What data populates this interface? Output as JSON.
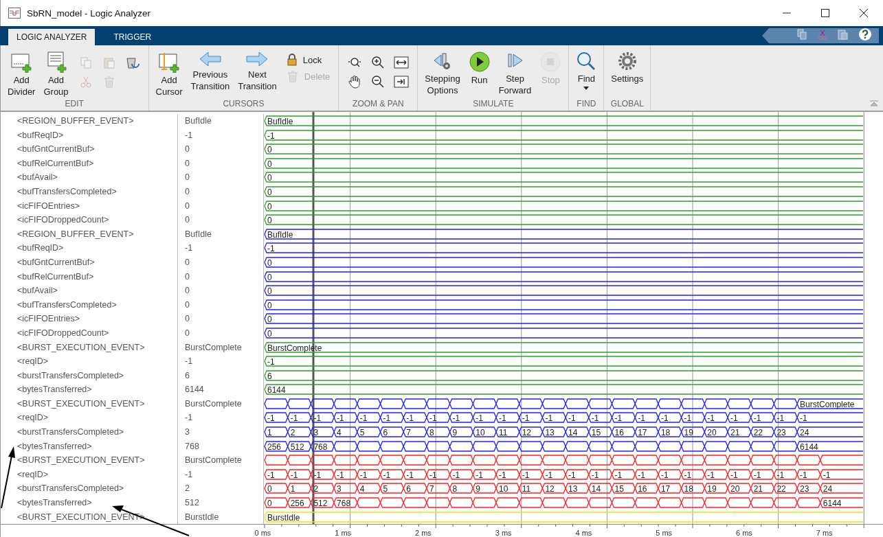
{
  "window": {
    "title": "SbRN_model - Logic Analyzer"
  },
  "tabs": [
    {
      "label": "LOGIC ANALYZER",
      "selected": true
    },
    {
      "label": "TRIGGER",
      "selected": false
    }
  ],
  "toolstrip": [
    {
      "title": "EDIT",
      "items": [
        {
          "kind": "large",
          "label": "Add Divider",
          "disabled": false
        },
        {
          "kind": "large",
          "label": "Add Group",
          "disabled": false
        },
        {
          "kind": "icon-grid",
          "buttons": [
            {
              "disabled": true
            },
            {
              "disabled": true
            },
            {
              "disabled": false
            },
            {
              "disabled": true
            },
            {
              "disabled": true
            }
          ]
        }
      ]
    },
    {
      "title": "CURSORS",
      "items": [
        {
          "kind": "large",
          "label": "Add Cursor",
          "disabled": false
        },
        {
          "kind": "large",
          "label": "Previous Transition",
          "disabled": false
        },
        {
          "kind": "large",
          "label": "Next Transition",
          "disabled": false
        },
        {
          "kind": "small-list",
          "buttons": [
            {
              "label": "Lock",
              "disabled": false
            },
            {
              "label": "Delete",
              "disabled": true
            }
          ]
        }
      ]
    },
    {
      "title": "ZOOM & PAN",
      "items": [
        {
          "kind": "icon-grid",
          "buttons": [
            {
              "disabled": false
            },
            {
              "disabled": false
            },
            {
              "disabled": false
            },
            {
              "disabled": false
            },
            {
              "disabled": false
            },
            {
              "disabled": false
            }
          ]
        }
      ]
    },
    {
      "title": "SIMULATE",
      "items": [
        {
          "kind": "large",
          "label": "Stepping Options",
          "disabled": false
        },
        {
          "kind": "large",
          "label": "Run",
          "disabled": false
        },
        {
          "kind": "large",
          "label": "Step Forward",
          "disabled": false
        },
        {
          "kind": "large",
          "label": "Stop",
          "disabled": true
        }
      ]
    },
    {
      "title": "FIND",
      "items": [
        {
          "kind": "large",
          "label": "Find",
          "disabled": false,
          "dropdown": true
        }
      ]
    },
    {
      "title": "GLOBAL",
      "items": [
        {
          "kind": "large",
          "label": "Settings",
          "disabled": false
        }
      ]
    }
  ],
  "signals": [
    {
      "name": "<REGION_BUFFER_EVENT>",
      "value": "BufIdle",
      "color": "#2ca02c",
      "segments": [
        {
          "kind": "value",
          "label": "BufIdle"
        }
      ]
    },
    {
      "name": "<bufReqID>",
      "value": "-1",
      "color": "#2ca02c",
      "segments": [
        {
          "kind": "value",
          "label": "-1"
        }
      ]
    },
    {
      "name": "<bufGntCurrentBuf>",
      "value": "0",
      "color": "#2ca02c",
      "segments": [
        {
          "kind": "value",
          "label": "0"
        }
      ]
    },
    {
      "name": "<bufRelCurrentBuf>",
      "value": "0",
      "color": "#2ca02c",
      "segments": [
        {
          "kind": "value",
          "label": "0"
        }
      ]
    },
    {
      "name": "<bufAvail>",
      "value": "0",
      "color": "#2ca02c",
      "segments": [
        {
          "kind": "value",
          "label": "0"
        }
      ]
    },
    {
      "name": "<bufTransfersCompleted>",
      "value": "0",
      "color": "#2ca02c",
      "segments": [
        {
          "kind": "value",
          "label": "0"
        }
      ]
    },
    {
      "name": "<icFIFOEntries>",
      "value": "0",
      "color": "#2ca02c",
      "segments": [
        {
          "kind": "value",
          "label": "0"
        }
      ]
    },
    {
      "name": "<icFIFODroppedCount>",
      "value": "0",
      "color": "#2ca02c",
      "segments": [
        {
          "kind": "value",
          "label": "0"
        }
      ]
    },
    {
      "name": "<REGION_BUFFER_EVENT>",
      "value": "BufIdle",
      "color": "#2020ff",
      "segments": [
        {
          "kind": "value",
          "label": "BufIdle"
        }
      ]
    },
    {
      "name": "<bufReqID>",
      "value": "-1",
      "color": "#2020ff",
      "segments": [
        {
          "kind": "value",
          "label": "-1"
        }
      ]
    },
    {
      "name": "<bufGntCurrentBuf>",
      "value": "0",
      "color": "#2020ff",
      "segments": [
        {
          "kind": "value",
          "label": "0"
        }
      ]
    },
    {
      "name": "<bufRelCurrentBuf>",
      "value": "0",
      "color": "#2020ff",
      "segments": [
        {
          "kind": "value",
          "label": "0"
        }
      ]
    },
    {
      "name": "<bufAvail>",
      "value": "0",
      "color": "#2020ff",
      "segments": [
        {
          "kind": "value",
          "label": "0"
        }
      ]
    },
    {
      "name": "<bufTransfersCompleted>",
      "value": "0",
      "color": "#2020ff",
      "segments": [
        {
          "kind": "value",
          "label": "0"
        }
      ]
    },
    {
      "name": "<icFIFOEntries>",
      "value": "0",
      "color": "#2020ff",
      "segments": [
        {
          "kind": "value",
          "label": "0"
        }
      ]
    },
    {
      "name": "<icFIFODroppedCount>",
      "value": "0",
      "color": "#2020ff",
      "segments": [
        {
          "kind": "value",
          "label": "0"
        }
      ]
    },
    {
      "name": "<BURST_EXECUTION_EVENT>",
      "value": "BurstComplete",
      "color": "#2ca02c",
      "segments": [
        {
          "kind": "value",
          "label": "BurstComplete"
        }
      ]
    },
    {
      "name": "<reqID>",
      "value": "-1",
      "color": "#2ca02c",
      "segments": [
        {
          "kind": "value",
          "label": "-1"
        }
      ]
    },
    {
      "name": "<burstTransfersCompleted>",
      "value": "6",
      "color": "#2ca02c",
      "segments": [
        {
          "kind": "value",
          "label": "6"
        }
      ]
    },
    {
      "name": "<bytesTransferred>",
      "value": "6144",
      "color": "#2ca02c",
      "segments": [
        {
          "kind": "value",
          "label": "6144"
        }
      ]
    },
    {
      "name": "<BURST_EXECUTION_EVENT>",
      "value": "BurstComplete",
      "color": "#2020ff",
      "segments": [
        {
          "kind": "blank"
        },
        {
          "kind": "blank"
        },
        {
          "kind": "blank"
        },
        {
          "kind": "blank"
        },
        {
          "kind": "blank"
        },
        {
          "kind": "blank"
        },
        {
          "kind": "blank"
        },
        {
          "kind": "blank"
        },
        {
          "kind": "blank"
        },
        {
          "kind": "blank"
        },
        {
          "kind": "blank"
        },
        {
          "kind": "blank"
        },
        {
          "kind": "blank"
        },
        {
          "kind": "blank"
        },
        {
          "kind": "blank"
        },
        {
          "kind": "blank"
        },
        {
          "kind": "blank"
        },
        {
          "kind": "blank"
        },
        {
          "kind": "blank"
        },
        {
          "kind": "blank"
        },
        {
          "kind": "blank"
        },
        {
          "kind": "blank"
        },
        {
          "kind": "blank"
        },
        {
          "kind": "value",
          "label": "BurstComplete"
        }
      ]
    },
    {
      "name": "<reqID>",
      "value": "-1",
      "color": "#2020ff",
      "segments": [
        {
          "kind": "value",
          "label": "-1"
        },
        {
          "kind": "value",
          "label": "-1"
        },
        {
          "kind": "value",
          "label": "-1"
        },
        {
          "kind": "value",
          "label": "-1"
        },
        {
          "kind": "value",
          "label": "-1"
        },
        {
          "kind": "value",
          "label": "-1"
        },
        {
          "kind": "value",
          "label": "-1"
        },
        {
          "kind": "value",
          "label": "-1"
        },
        {
          "kind": "value",
          "label": "-1"
        },
        {
          "kind": "value",
          "label": "-1"
        },
        {
          "kind": "value",
          "label": "-1"
        },
        {
          "kind": "value",
          "label": "-1"
        },
        {
          "kind": "value",
          "label": "-1"
        },
        {
          "kind": "value",
          "label": "-1"
        },
        {
          "kind": "value",
          "label": "-1"
        },
        {
          "kind": "value",
          "label": "-1"
        },
        {
          "kind": "value",
          "label": "-1"
        },
        {
          "kind": "value",
          "label": "-1"
        },
        {
          "kind": "value",
          "label": "-1"
        },
        {
          "kind": "value",
          "label": "-1"
        },
        {
          "kind": "value",
          "label": "-1"
        },
        {
          "kind": "value",
          "label": "-1"
        },
        {
          "kind": "value",
          "label": "-1"
        },
        {
          "kind": "value",
          "label": "-1"
        }
      ]
    },
    {
      "name": "<burstTransfersCompleted>",
      "value": "3",
      "color": "#2020ff",
      "segments": [
        {
          "kind": "value",
          "label": "1"
        },
        {
          "kind": "value",
          "label": "2"
        },
        {
          "kind": "value",
          "label": "3"
        },
        {
          "kind": "value",
          "label": "4"
        },
        {
          "kind": "value",
          "label": "5"
        },
        {
          "kind": "value",
          "label": "6"
        },
        {
          "kind": "value",
          "label": "7"
        },
        {
          "kind": "value",
          "label": "8"
        },
        {
          "kind": "value",
          "label": "9"
        },
        {
          "kind": "value",
          "label": "10"
        },
        {
          "kind": "value",
          "label": "11"
        },
        {
          "kind": "value",
          "label": "12"
        },
        {
          "kind": "value",
          "label": "13"
        },
        {
          "kind": "value",
          "label": "14"
        },
        {
          "kind": "value",
          "label": "15"
        },
        {
          "kind": "value",
          "label": "16"
        },
        {
          "kind": "value",
          "label": "17"
        },
        {
          "kind": "value",
          "label": "18"
        },
        {
          "kind": "value",
          "label": "19"
        },
        {
          "kind": "value",
          "label": "20"
        },
        {
          "kind": "value",
          "label": "21"
        },
        {
          "kind": "value",
          "label": "22"
        },
        {
          "kind": "value",
          "label": "23"
        },
        {
          "kind": "value",
          "label": "24"
        }
      ]
    },
    {
      "name": "<bytesTransferred>",
      "value": "768",
      "color": "#2020ff",
      "segments": [
        {
          "kind": "value",
          "label": "256"
        },
        {
          "kind": "value",
          "label": "512"
        },
        {
          "kind": "value",
          "label": "768"
        },
        {
          "kind": "blank"
        },
        {
          "kind": "blank"
        },
        {
          "kind": "blank"
        },
        {
          "kind": "blank"
        },
        {
          "kind": "blank"
        },
        {
          "kind": "blank"
        },
        {
          "kind": "blank"
        },
        {
          "kind": "blank"
        },
        {
          "kind": "blank"
        },
        {
          "kind": "blank"
        },
        {
          "kind": "blank"
        },
        {
          "kind": "blank"
        },
        {
          "kind": "blank"
        },
        {
          "kind": "blank"
        },
        {
          "kind": "blank"
        },
        {
          "kind": "blank"
        },
        {
          "kind": "blank"
        },
        {
          "kind": "blank"
        },
        {
          "kind": "blank"
        },
        {
          "kind": "blank"
        },
        {
          "kind": "value",
          "label": "6144"
        }
      ]
    },
    {
      "name": "<BURST_EXECUTION_EVENT>",
      "value": "BurstComplete",
      "color": "#ff2020",
      "segments": [
        {
          "kind": "blank"
        },
        {
          "kind": "blank"
        },
        {
          "kind": "blank"
        },
        {
          "kind": "blank"
        },
        {
          "kind": "blank"
        },
        {
          "kind": "blank"
        },
        {
          "kind": "blank"
        },
        {
          "kind": "blank"
        },
        {
          "kind": "blank"
        },
        {
          "kind": "blank"
        },
        {
          "kind": "blank"
        },
        {
          "kind": "blank"
        },
        {
          "kind": "blank"
        },
        {
          "kind": "blank"
        },
        {
          "kind": "blank"
        },
        {
          "kind": "blank"
        },
        {
          "kind": "blank"
        },
        {
          "kind": "blank"
        },
        {
          "kind": "blank"
        },
        {
          "kind": "blank"
        },
        {
          "kind": "blank"
        },
        {
          "kind": "blank"
        },
        {
          "kind": "blank"
        },
        {
          "kind": "blank"
        },
        {
          "kind": "blank"
        }
      ]
    },
    {
      "name": "<reqID>",
      "value": "-1",
      "color": "#ff2020",
      "segments": [
        {
          "kind": "value",
          "label": "-1"
        },
        {
          "kind": "value",
          "label": "-1"
        },
        {
          "kind": "value",
          "label": "-1"
        },
        {
          "kind": "value",
          "label": "-1"
        },
        {
          "kind": "value",
          "label": "-1"
        },
        {
          "kind": "value",
          "label": "-1"
        },
        {
          "kind": "value",
          "label": "-1"
        },
        {
          "kind": "value",
          "label": "-1"
        },
        {
          "kind": "value",
          "label": "-1"
        },
        {
          "kind": "value",
          "label": "-1"
        },
        {
          "kind": "value",
          "label": "-1"
        },
        {
          "kind": "value",
          "label": "-1"
        },
        {
          "kind": "value",
          "label": "-1"
        },
        {
          "kind": "value",
          "label": "-1"
        },
        {
          "kind": "value",
          "label": "-1"
        },
        {
          "kind": "value",
          "label": "-1"
        },
        {
          "kind": "value",
          "label": "-1"
        },
        {
          "kind": "value",
          "label": "-1"
        },
        {
          "kind": "value",
          "label": "-1"
        },
        {
          "kind": "value",
          "label": "-1"
        },
        {
          "kind": "value",
          "label": "-1"
        },
        {
          "kind": "value",
          "label": "-1"
        },
        {
          "kind": "value",
          "label": "-1"
        },
        {
          "kind": "value",
          "label": "-1"
        },
        {
          "kind": "value",
          "label": "-1"
        }
      ]
    },
    {
      "name": "<burstTransfersCompleted>",
      "value": "2",
      "color": "#ff2020",
      "segments": [
        {
          "kind": "value",
          "label": "0"
        },
        {
          "kind": "value",
          "label": "1"
        },
        {
          "kind": "value",
          "label": "2"
        },
        {
          "kind": "value",
          "label": "3"
        },
        {
          "kind": "value",
          "label": "4"
        },
        {
          "kind": "value",
          "label": "5"
        },
        {
          "kind": "value",
          "label": "6"
        },
        {
          "kind": "value",
          "label": "7"
        },
        {
          "kind": "value",
          "label": "8"
        },
        {
          "kind": "value",
          "label": "9"
        },
        {
          "kind": "value",
          "label": "10"
        },
        {
          "kind": "value",
          "label": "11"
        },
        {
          "kind": "value",
          "label": "12"
        },
        {
          "kind": "value",
          "label": "13"
        },
        {
          "kind": "value",
          "label": "14"
        },
        {
          "kind": "value",
          "label": "15"
        },
        {
          "kind": "value",
          "label": "16"
        },
        {
          "kind": "value",
          "label": "17"
        },
        {
          "kind": "value",
          "label": "18"
        },
        {
          "kind": "value",
          "label": "19"
        },
        {
          "kind": "value",
          "label": "20"
        },
        {
          "kind": "value",
          "label": "21"
        },
        {
          "kind": "value",
          "label": "22"
        },
        {
          "kind": "value",
          "label": "23"
        },
        {
          "kind": "value",
          "label": "24"
        }
      ]
    },
    {
      "name": "<bytesTransferred>",
      "value": "512",
      "color": "#ff2020",
      "segments": [
        {
          "kind": "value",
          "label": "0"
        },
        {
          "kind": "value",
          "label": "256"
        },
        {
          "kind": "value",
          "label": "512"
        },
        {
          "kind": "value",
          "label": "768"
        },
        {
          "kind": "blank"
        },
        {
          "kind": "blank"
        },
        {
          "kind": "blank"
        },
        {
          "kind": "blank"
        },
        {
          "kind": "blank"
        },
        {
          "kind": "blank"
        },
        {
          "kind": "blank"
        },
        {
          "kind": "blank"
        },
        {
          "kind": "blank"
        },
        {
          "kind": "blank"
        },
        {
          "kind": "blank"
        },
        {
          "kind": "blank"
        },
        {
          "kind": "blank"
        },
        {
          "kind": "blank"
        },
        {
          "kind": "blank"
        },
        {
          "kind": "blank"
        },
        {
          "kind": "blank"
        },
        {
          "kind": "blank"
        },
        {
          "kind": "blank"
        },
        {
          "kind": "blank"
        },
        {
          "kind": "value",
          "label": "6144"
        }
      ]
    },
    {
      "name": "<BURST_EXECUTION_EVENT>",
      "value": "BurstIdle",
      "color": "#e8e800",
      "segments": [
        {
          "kind": "value",
          "label": "BurstIdle"
        }
      ]
    }
  ],
  "time_axis": {
    "ticks": [
      "0 ms",
      "1 ms",
      "2 ms",
      "3 ms",
      "4 ms",
      "5 ms",
      "6 ms",
      "7 ms"
    ]
  }
}
